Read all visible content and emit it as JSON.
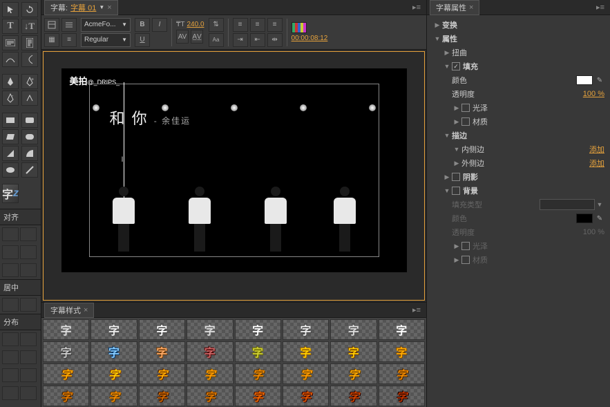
{
  "tabs": {
    "main": {
      "prefix": "字幕:",
      "name": "字幕 01",
      "close": "×"
    },
    "styles": "字幕样式",
    "props": "字幕属性"
  },
  "toolbar": {
    "font_family": "AcmeFo...",
    "font_weight": "Regular",
    "font_size": "240.0",
    "timecode": "00:00:08:12"
  },
  "preview": {
    "watermark": "美拍",
    "watermark_sub": "@_DRIPS_",
    "title_main": "和 你",
    "title_sub": "- 余佳运"
  },
  "left": {
    "align": "对齐",
    "center": "居中",
    "distribute": "分布",
    "zi": "字",
    "z": "z"
  },
  "props": {
    "transform": "变换",
    "attributes": "属性",
    "distort": "扭曲",
    "fill": "填充",
    "color": "颜色",
    "opacity": "透明度",
    "opacity_val": "100 %",
    "sheen": "光泽",
    "texture": "材质",
    "stroke": "描边",
    "inner_stroke": "内侧边",
    "outer_stroke": "外侧边",
    "add": "添加",
    "shadow": "阴影",
    "background": "背景",
    "fill_type": "填充类型",
    "bg_opacity_val": "100 %"
  },
  "style_glyph": "字",
  "menu_glyph": "▸≡"
}
